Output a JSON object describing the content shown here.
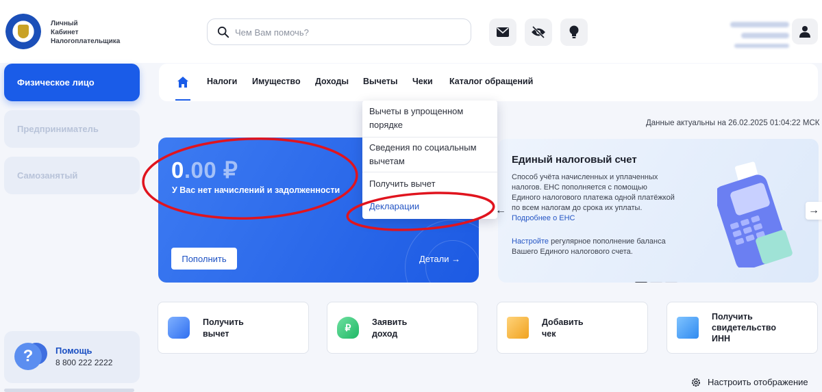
{
  "header": {
    "logo_lines": [
      "Личный",
      "Кабинет",
      "Налогоплательщика"
    ],
    "search_placeholder": "Чем Вам помочь?"
  },
  "sidebar": {
    "items": [
      {
        "label": "Физическое лицо",
        "active": true
      },
      {
        "label": "Предприниматель",
        "active": false
      },
      {
        "label": "Самозанятый",
        "active": false
      }
    ],
    "help": {
      "title": "Помощь",
      "phone": "8 800 222 2222"
    }
  },
  "nav": {
    "items": [
      "Налоги",
      "Имущество",
      "Доходы",
      "Вычеты",
      "Чеки",
      "Каталог обращений"
    ]
  },
  "dropdown": {
    "items": [
      {
        "label": "Вычеты в упрощенном порядке"
      },
      {
        "label": "Сведения по социальным вычетам"
      },
      {
        "label": "Получить вычет"
      },
      {
        "label": "Декларации"
      }
    ]
  },
  "data_date": "Данные актуальны на 26.02.2025 01:04:22 МСК",
  "balance": {
    "amount_int": "0",
    "amount_dec": ".00 ₽",
    "note": "У Вас нет начислений и задолженности",
    "topup_label": "Пополнить",
    "details_label": "Детали"
  },
  "ens": {
    "title": "Единый налоговый счет",
    "desc": "Способ учёта начисленных и уплаченных налогов. ЕНС пополняется с помощью Единого налогового платежа одной платёжкой по всем налогам до срока их уплаты.",
    "desc_link": "Подробнее о ЕНС",
    "desc2_link": "Настройте",
    "desc2": " регулярное пополнение баланса Вашего Единого налогового счета."
  },
  "quick_actions": [
    {
      "line1": "Получить",
      "line2": "вычет",
      "icon": "card-icon"
    },
    {
      "line1": "Заявить",
      "line2": "доход",
      "icon": "ruble-bag-icon"
    },
    {
      "line1": "Добавить",
      "line2": "чек",
      "icon": "receipt-icon"
    },
    {
      "line1": "Получить",
      "line2": "свидетельство",
      "line3": "ИНН",
      "icon": "monitor-icon"
    }
  ],
  "configure_label": "Настроить отображение",
  "colors": {
    "accent": "#1a5ce8",
    "annotation": "#e0141e"
  }
}
